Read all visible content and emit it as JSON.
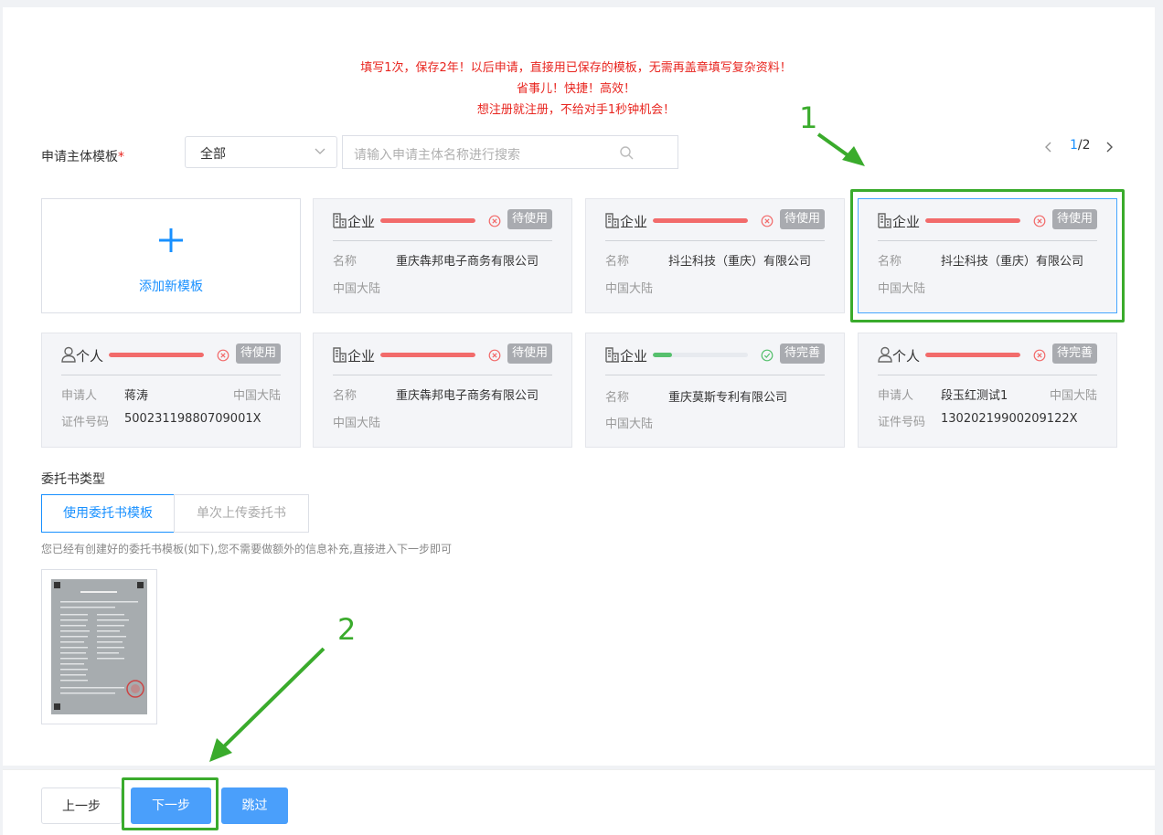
{
  "notice": {
    "line1": "填写1次，保存2年！以后申请，直接用已保存的模板，无需再盖章填写复杂资料！",
    "line2": "省事儿！快捷！高效！",
    "line3": "想注册就注册，不给对手1秒钟机会！"
  },
  "filter": {
    "label": "申请主体模板",
    "required": "*",
    "select_value": "全部",
    "search_placeholder": "请输入申请主体名称进行搜索"
  },
  "pagination": {
    "current": "1",
    "total": "/2"
  },
  "add_card": {
    "plus": "+",
    "label": "添加新模板"
  },
  "cards": [
    {
      "type": "企业",
      "status": "待使用",
      "progress": 1.0,
      "row1_label": "名称",
      "row1_value": "重庆犇邦电子商务有限公司",
      "row2_label": "中国大陆"
    },
    {
      "type": "企业",
      "status": "待使用",
      "progress": 1.0,
      "row1_label": "名称",
      "row1_value": "抖尘科技（重庆）有限公司",
      "row2_label": "中国大陆"
    },
    {
      "type": "企业",
      "status": "待使用",
      "progress": 1.0,
      "row1_label": "名称",
      "row1_value": "抖尘科技（重庆）有限公司",
      "row2_label": "中国大陆"
    },
    {
      "type": "个人",
      "status": "待使用",
      "progress": 1.0,
      "row1_label": "申请人",
      "row1_value": "蒋涛",
      "row1_right": "中国大陆",
      "row2_label": "证件号码",
      "row2_value": "50023119880709001X"
    },
    {
      "type": "企业",
      "status": "待使用",
      "progress": 1.0,
      "row1_label": "名称",
      "row1_value": "重庆犇邦电子商务有限公司",
      "row2_label": "中国大陆"
    },
    {
      "type": "企业",
      "status": "待完善",
      "progress": 0.2,
      "row1_label": "名称",
      "row1_value": "重庆莫斯专利有限公司",
      "row2_label": "中国大陆"
    },
    {
      "type": "个人",
      "status": "待完善",
      "progress": 1.0,
      "row1_label": "申请人",
      "row1_value": "段玉红测试1",
      "row1_right": "中国大陆",
      "row2_label": "证件号码",
      "row2_value": "13020219900209122X"
    }
  ],
  "letter": {
    "title": "委托书类型",
    "tab_template": "使用委托书模板",
    "tab_upload": "单次上传委托书",
    "hint": "您已经有创建好的委托书模板(如下),您不需要做额外的信息补充,直接进入下一步即可"
  },
  "annotations": {
    "a1": "1",
    "a2": "2"
  },
  "buttons": {
    "prev": "上一步",
    "next": "下一步",
    "skip": "跳过"
  },
  "colors": {
    "accent": "#1890ff",
    "highlight": "#3aab2c",
    "notice": "#e8251f",
    "bar_red": "#f26b6b",
    "bar_green": "#56c06d"
  }
}
